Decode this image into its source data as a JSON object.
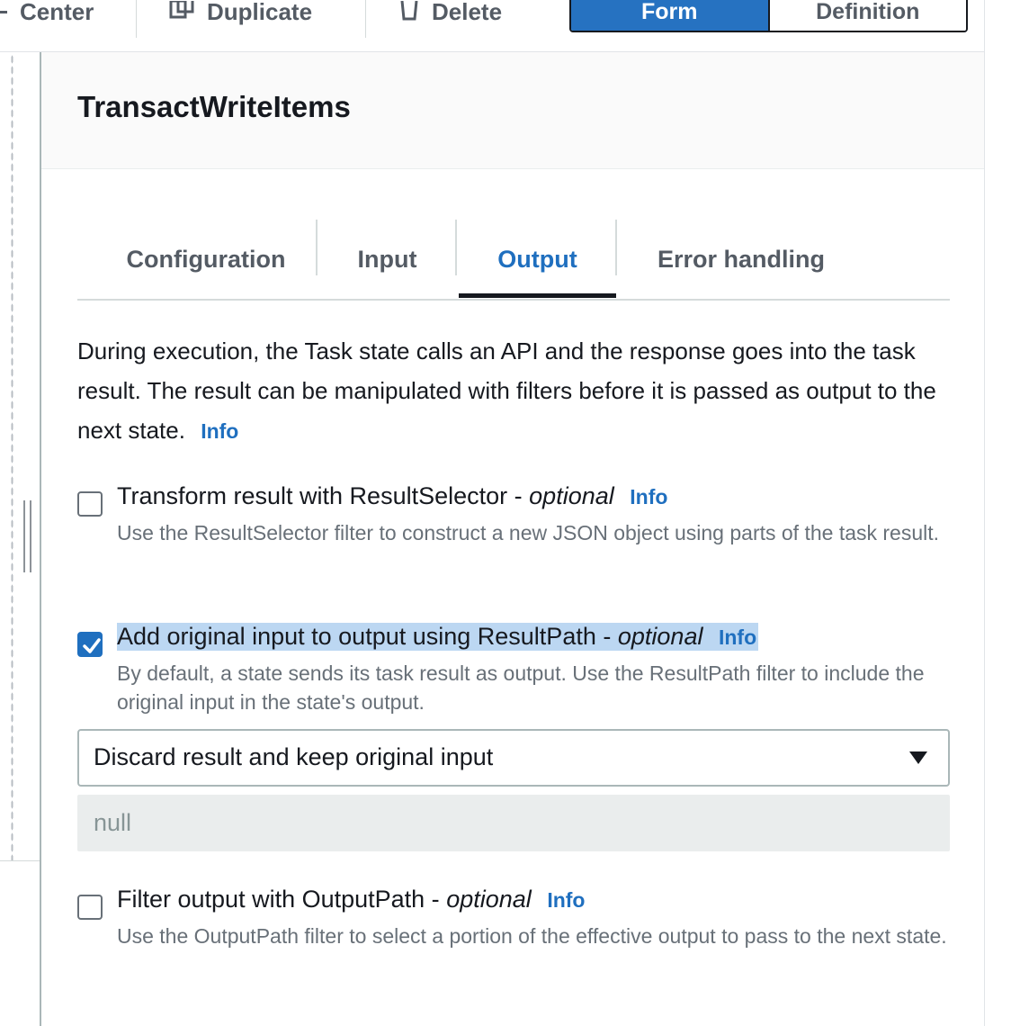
{
  "toolbar": {
    "center_label": "Center",
    "duplicate_label": "Duplicate",
    "delete_label": "Delete",
    "view_toggle": {
      "form": "Form",
      "definition": "Definition",
      "selected": "Form"
    }
  },
  "panel": {
    "title": "TransactWriteItems",
    "tabs": [
      {
        "label": "Configuration"
      },
      {
        "label": "Input"
      },
      {
        "label": "Output"
      },
      {
        "label": "Error handling"
      }
    ],
    "active_tab": "Output",
    "description": "During execution, the Task state calls an API and the response goes into the task result. The result can be manipulated with filters before it is passed as output to the next state.",
    "info_label": "Info",
    "options": [
      {
        "label": "Transform result with ResultSelector -",
        "optional": "optional",
        "info": "Info",
        "description": "Use the ResultSelector filter to construct a new JSON object using parts of the task result.",
        "checked": false
      },
      {
        "label": "Add original input to output using ResultPath -",
        "optional": "optional",
        "info": "Info",
        "description": "By default, a state sends its task result as output. Use the ResultPath filter to include the original input in the state's output.",
        "checked": true
      },
      {
        "label": "Filter output with OutputPath -",
        "optional": "optional",
        "info": "Info",
        "description": "Use the OutputPath filter to select a portion of the effective output to pass to the next state.",
        "checked": false
      }
    ],
    "result_path_select": {
      "value": "Discard result and keep original input"
    },
    "result_path_value": "null"
  },
  "colors": {
    "accent": "#1f6fbf",
    "segment_active": "#2672c1",
    "highlight": "#bcd7f2",
    "muted_text": "#687078"
  }
}
